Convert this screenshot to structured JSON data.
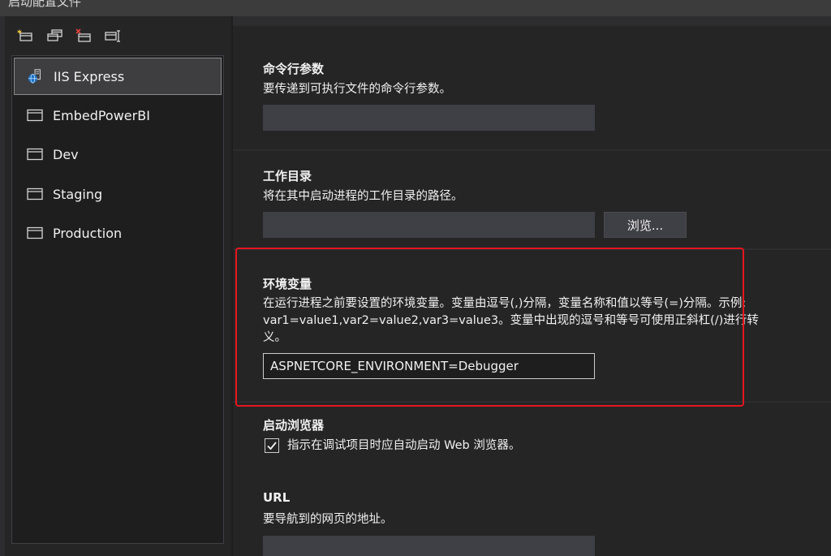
{
  "window": {
    "title": "启动配置文件"
  },
  "toolbar": {
    "buttons": [
      {
        "name": "new-profile-icon"
      },
      {
        "name": "copy-profile-icon"
      },
      {
        "name": "delete-profile-icon"
      },
      {
        "name": "rename-profile-icon"
      }
    ]
  },
  "profiles": [
    {
      "label": "IIS Express",
      "icon": "iis-globe-icon",
      "selected": true
    },
    {
      "label": "EmbedPowerBI",
      "icon": "window-icon"
    },
    {
      "label": "Dev",
      "icon": "window-icon"
    },
    {
      "label": "Staging",
      "icon": "window-icon"
    },
    {
      "label": "Production",
      "icon": "window-icon"
    }
  ],
  "settings": {
    "command_args": {
      "title": "命令行参数",
      "description": "要传递到可执行文件的命令行参数。",
      "value": ""
    },
    "working_dir": {
      "title": "工作目录",
      "description": "将在其中启动进程的工作目录的路径。",
      "value": "",
      "browse_label": "浏览..."
    },
    "env_vars": {
      "title": "环境变量",
      "description_line1": "在运行进程之前要设置的环境变量。变量由逗号(,)分隔，变量名称和值以等号(=)分隔。示例:",
      "description_line2": "var1=value1,var2=value2,var3=value3。变量中出现的逗号和等号可使用正斜杠(/)进行转",
      "description_line3": "义。",
      "value": "ASPNETCORE_ENVIRONMENT=Debugger"
    },
    "launch_browser": {
      "title": "启动浏览器",
      "checkbox_label": "指示在调试项目时应自动启动 Web 浏览器。",
      "checked": true
    },
    "url": {
      "title": "URL",
      "description": "要导航到的网页的地址。",
      "value": ""
    }
  },
  "colors": {
    "highlight_box": "#e8151c",
    "selected_item_bg": "#3e3e40",
    "panel_bg": "#252526"
  }
}
